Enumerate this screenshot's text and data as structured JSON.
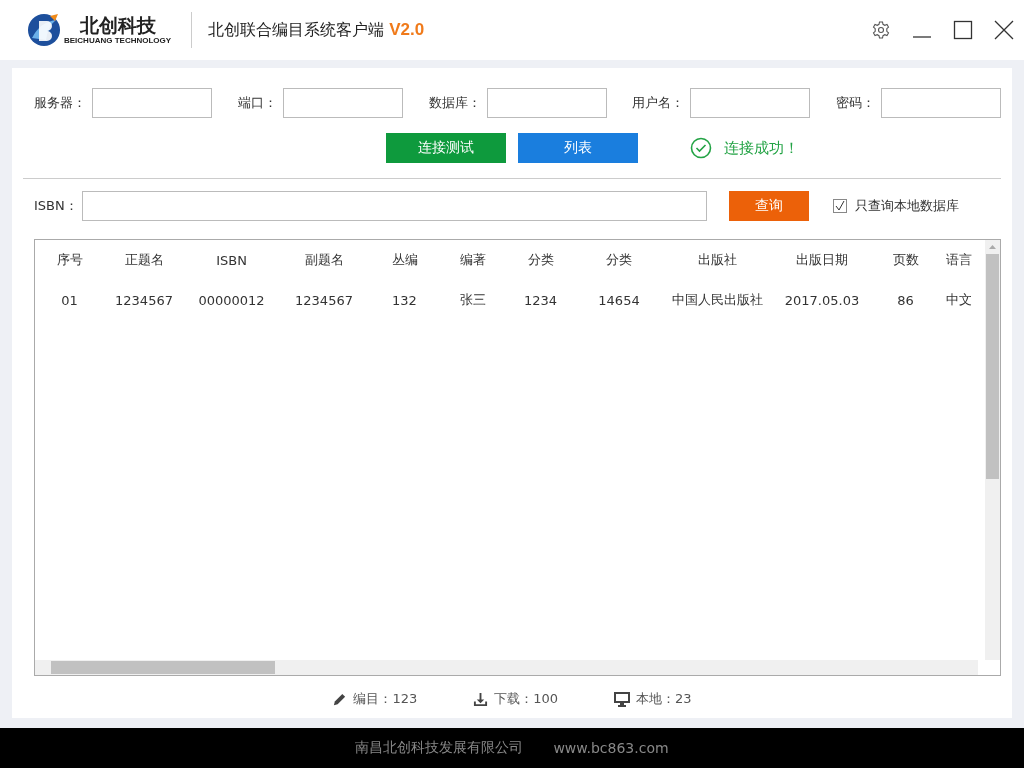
{
  "header": {
    "logo_text": "北创科技",
    "logo_subtext": "BEICHUANG TECHNOLOGY",
    "title": "北创联合编目系统客户端",
    "version": "V2.0"
  },
  "connection": {
    "fields": [
      {
        "label": "服务器："
      },
      {
        "label": "端口："
      },
      {
        "label": "数据库："
      },
      {
        "label": "用户名："
      },
      {
        "label": "密码："
      }
    ],
    "buttons": [
      {
        "label": "连接测试",
        "kind": "green"
      },
      {
        "label": "列表",
        "kind": "blue"
      }
    ],
    "status": "连接成功！"
  },
  "search": {
    "label": "ISBN：",
    "button": "查询",
    "local_only": {
      "label": "只查询本地数据库",
      "checked": true
    }
  },
  "table": {
    "columns": [
      "序号",
      "正题名",
      "ISBN",
      "副题名",
      "丛编",
      "编著",
      "分类",
      "分类",
      "出版社",
      "出版日期",
      "页数",
      "语言"
    ],
    "rows": [
      [
        "01",
        "1234567",
        "00000012",
        "1234567",
        "132",
        "张三",
        "1234",
        "14654",
        "中国人民出版社",
        "2017.05.03",
        "86",
        "中文"
      ]
    ]
  },
  "status_bar": [
    {
      "kind": "edit",
      "text": "编目：123"
    },
    {
      "kind": "download",
      "text": "下载：100"
    },
    {
      "kind": "local",
      "text": "本地：23"
    }
  ],
  "footer": {
    "company": "南昌北创科技发展有限公司",
    "website": "www.bc863.com"
  }
}
